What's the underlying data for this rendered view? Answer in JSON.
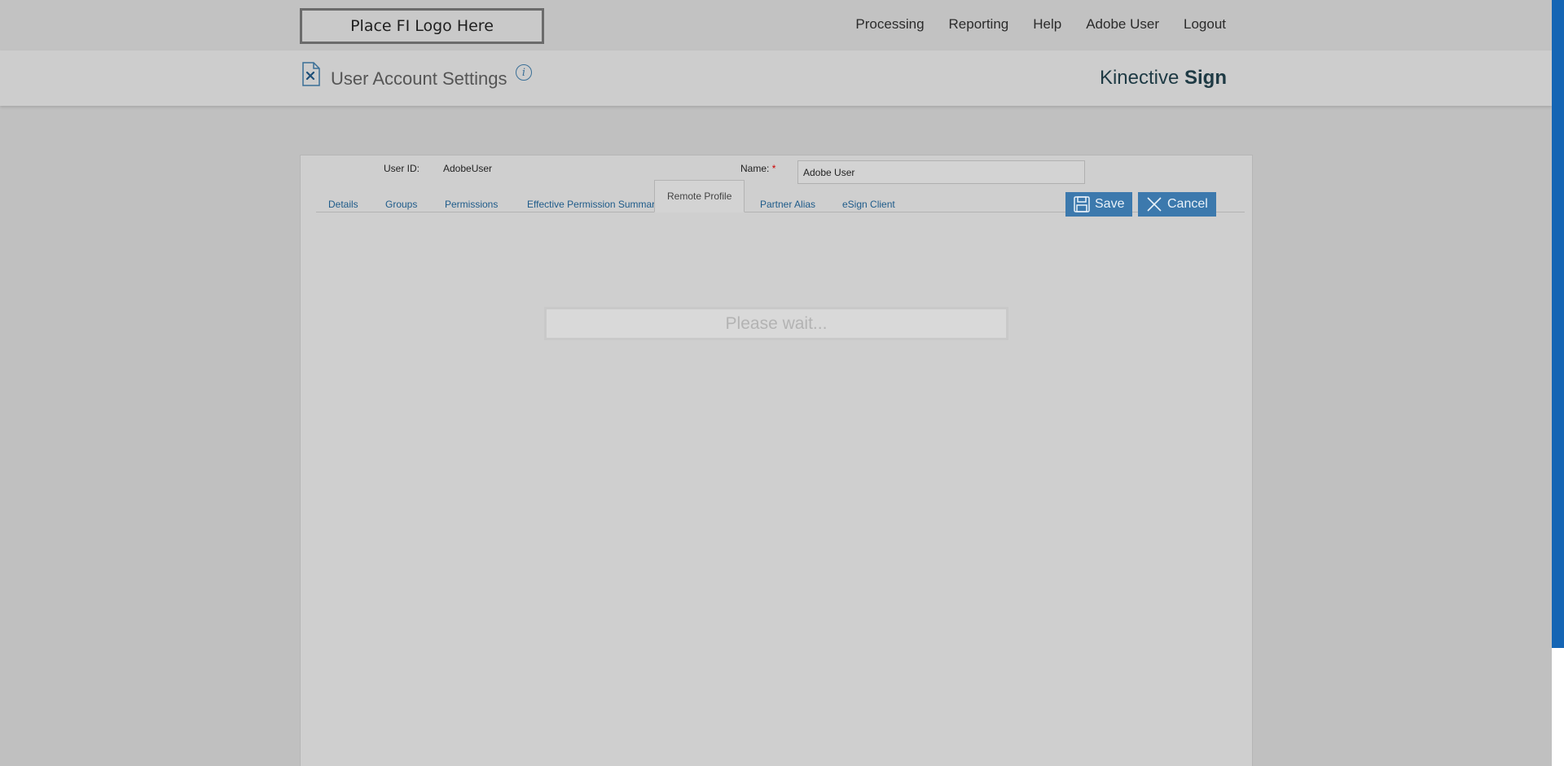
{
  "topbar": {
    "logo_text": "Place FI Logo Here",
    "nav": [
      "Processing",
      "Reporting",
      "Help",
      "Adobe User",
      "Logout"
    ]
  },
  "header": {
    "page_title": "User Account Settings",
    "info_icon": "i",
    "brand_light": "Kinective",
    "brand_bold": "Sign"
  },
  "form": {
    "user_id_label": "User ID:",
    "user_id_value": "AdobeUser",
    "name_label": "Name:",
    "required_mark": "*",
    "name_value": "Adobe User"
  },
  "tabs": [
    {
      "label": "Details",
      "active": false
    },
    {
      "label": "Groups",
      "active": false
    },
    {
      "label": "Permissions",
      "active": false
    },
    {
      "label": "Effective Permission Summary",
      "active": false
    },
    {
      "label": "Remote Profile",
      "active": true
    },
    {
      "label": "Partner Alias",
      "active": false
    },
    {
      "label": "eSign Client",
      "active": false
    }
  ],
  "buttons": {
    "save_label": "Save",
    "cancel_label": "Cancel"
  },
  "status": {
    "wait_text": "Please wait..."
  },
  "colors": {
    "accent": "#3c79ad",
    "link": "#1e5b8a",
    "scrollbar": "#1565b4"
  }
}
